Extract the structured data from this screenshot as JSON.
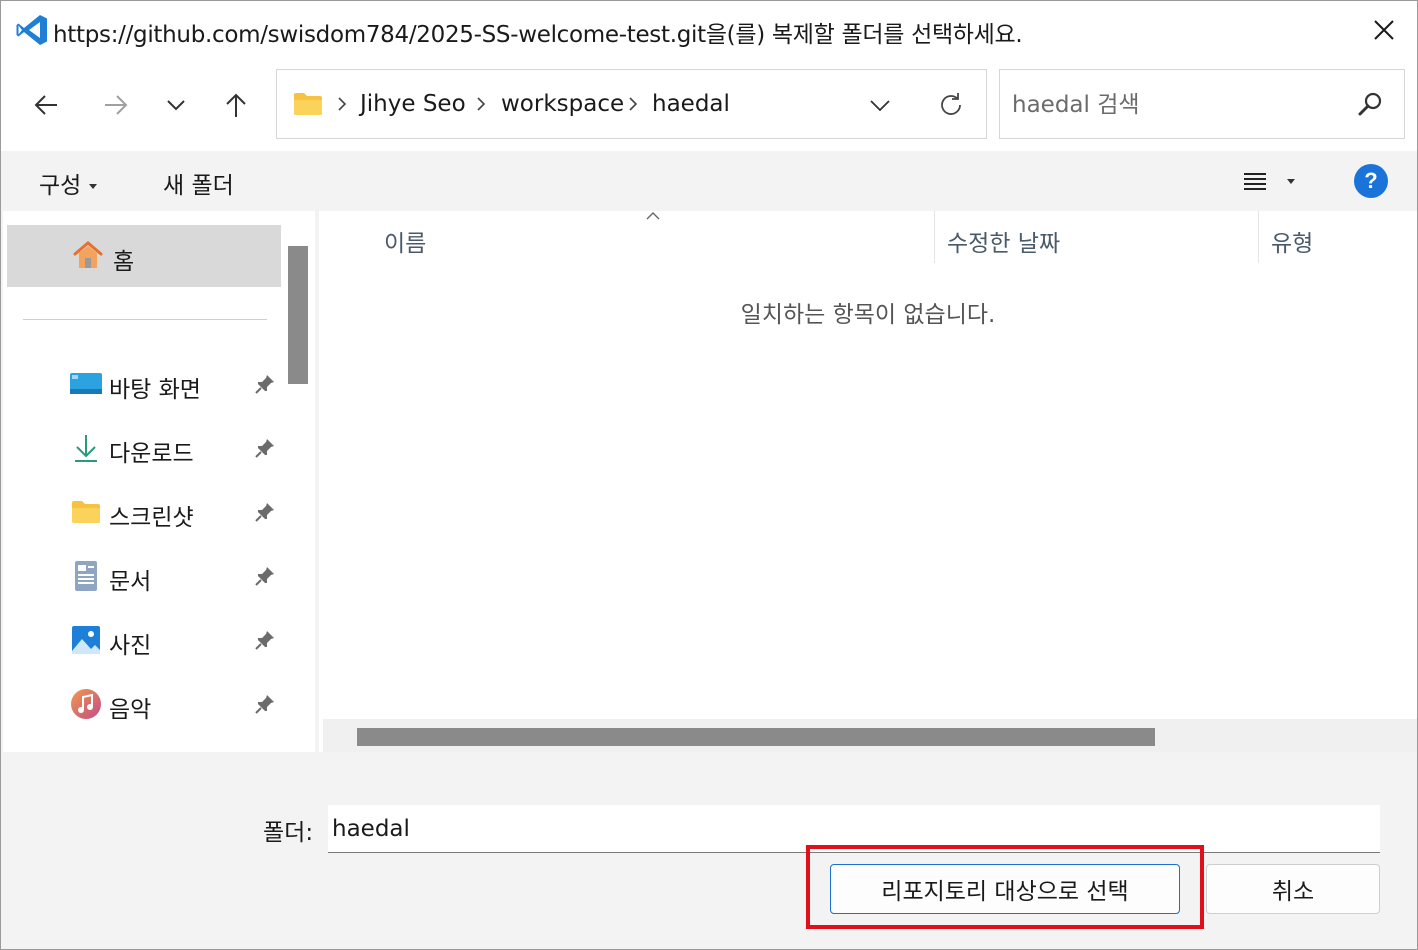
{
  "window": {
    "title": "https://github.com/swisdom784/2025-SS-welcome-test.git을(를) 복제할 폴더를 선택하세요.",
    "app_icon": "vscode-icon",
    "close_icon": "close-icon"
  },
  "nav": {
    "back_icon": "arrow-left-icon",
    "forward_icon": "arrow-right-icon",
    "recent_icon": "chevron-down-icon",
    "up_icon": "arrow-up-icon"
  },
  "address": {
    "crumbs": [
      "Jihye Seo",
      "workspace",
      "haedal"
    ],
    "dropdown_icon": "chevron-down-icon",
    "refresh_icon": "refresh-icon"
  },
  "search": {
    "placeholder": "haedal 검색",
    "icon": "search-icon"
  },
  "toolbar": {
    "organize_label": "구성",
    "new_folder_label": "새 폴더",
    "view_icon": "view-list-icon",
    "help_label": "?"
  },
  "sidebar": {
    "home_label": "홈",
    "items": [
      {
        "label": "바탕 화면",
        "icon": "desktop-icon"
      },
      {
        "label": "다운로드",
        "icon": "download-icon"
      },
      {
        "label": "스크린샷",
        "icon": "folder-icon"
      },
      {
        "label": "문서",
        "icon": "document-icon"
      },
      {
        "label": "사진",
        "icon": "pictures-icon"
      },
      {
        "label": "음악",
        "icon": "music-icon"
      }
    ]
  },
  "content": {
    "columns": [
      "이름",
      "수정한 날짜",
      "유형"
    ],
    "empty_message": "일치하는 항목이 없습니다."
  },
  "footer": {
    "folder_label": "폴더:",
    "folder_value": "haedal",
    "select_button": "리포지토리 대상으로 선택",
    "cancel_button": "취소"
  },
  "colors": {
    "accent": "#1a73d9",
    "highlight": "#e0101a"
  }
}
